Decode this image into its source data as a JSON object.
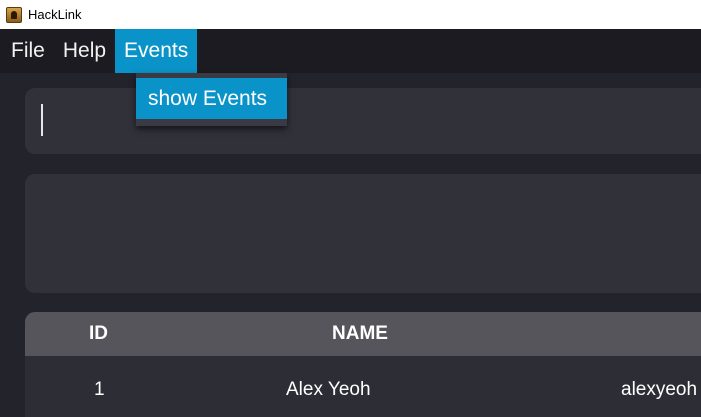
{
  "window": {
    "title": "HackLink"
  },
  "menu": {
    "items": [
      {
        "label": "File"
      },
      {
        "label": "Help"
      },
      {
        "label": "Events"
      }
    ],
    "dropdown": {
      "items": [
        {
          "label": "show Events"
        }
      ]
    }
  },
  "command_box": {
    "value": ""
  },
  "table": {
    "columns": [
      "ID",
      "NAME"
    ],
    "rows": [
      {
        "id": "1",
        "name": "Alex Yeoh",
        "email": "alexyeoh"
      }
    ]
  },
  "colors": {
    "accent": "#0a93c9",
    "menubar": "#1b1b21",
    "panel": "#31313a",
    "table_header": "#55555b"
  }
}
